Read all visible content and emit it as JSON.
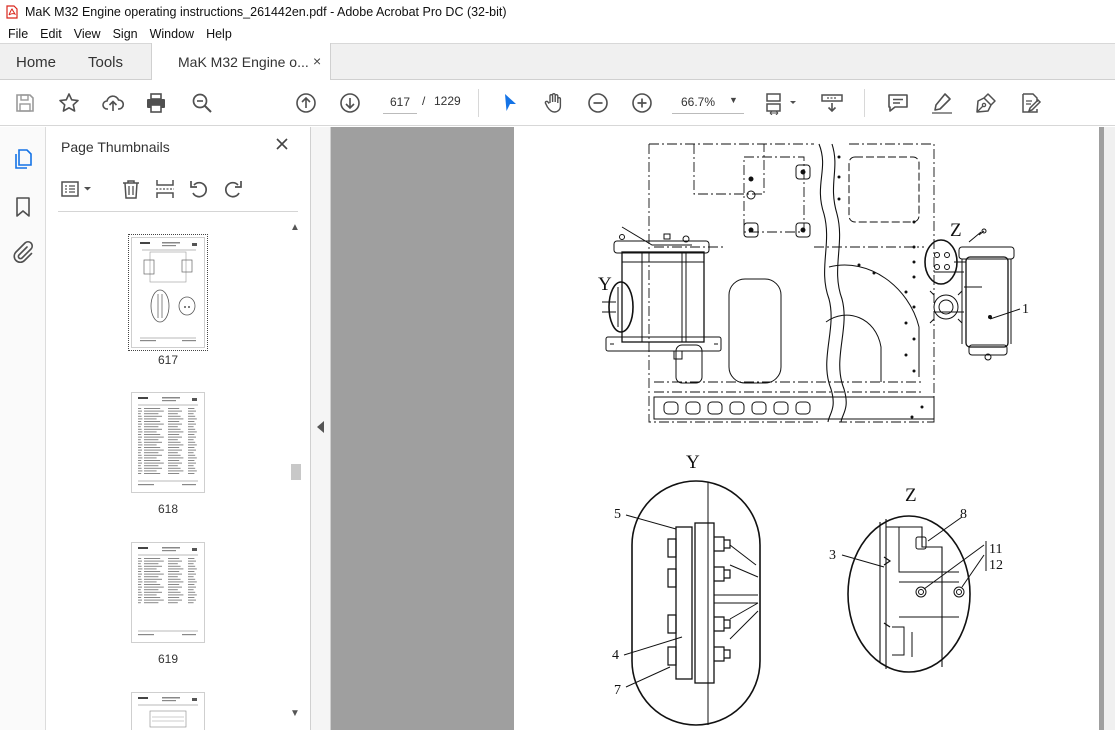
{
  "window": {
    "title": "MaK M32 Engine operating instructions_261442en.pdf - Adobe Acrobat Pro DC (32-bit)"
  },
  "menu": [
    "File",
    "Edit",
    "View",
    "Sign",
    "Window",
    "Help"
  ],
  "tabs": {
    "home": "Home",
    "tools": "Tools",
    "document": "MaK M32 Engine o...",
    "close": "×"
  },
  "toolbar": {
    "current_page": "617",
    "page_separator": "/",
    "total_pages": "1229",
    "zoom": "66.7%",
    "zoom_caret": "▼"
  },
  "thumbnails_panel": {
    "title": "Page Thumbnails",
    "pages": [
      {
        "label": "617",
        "selected": true
      },
      {
        "label": "618",
        "selected": false
      },
      {
        "label": "619",
        "selected": false
      },
      {
        "label": "",
        "selected": false
      }
    ]
  },
  "drawing_labels": {
    "Y_top": "Y",
    "Z_top": "Z",
    "one": "1",
    "Y_detail": "Y",
    "Z_detail": "Z",
    "five": "5",
    "four": "4",
    "seven": "7",
    "three": "3",
    "eight": "8",
    "eleven": "11",
    "twelve": "12"
  },
  "colors": {
    "accent_blue": "#1473e6",
    "icon_gray": "#505050",
    "doc_background": "#9f9f9f",
    "app_icon_red": "#d9261c"
  }
}
